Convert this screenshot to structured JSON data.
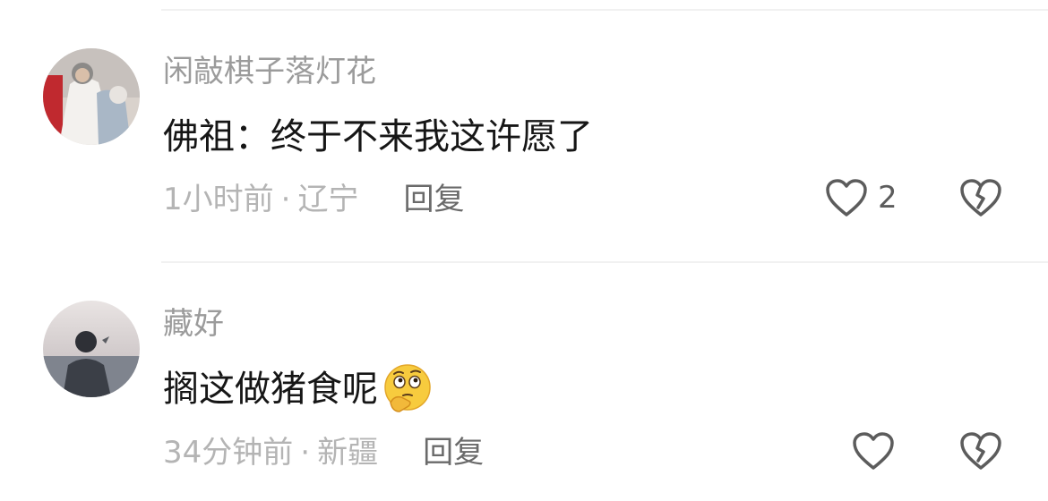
{
  "comments": [
    {
      "username": "闲敲棋子落灯花",
      "text": "佛祖：终于不来我这许愿了",
      "time": "1小时前",
      "separator": "·",
      "location": "辽宁",
      "reply_label": "回复",
      "like_count": "2",
      "like_icon": "heart-outline-icon",
      "dislike_icon": "broken-heart-icon"
    },
    {
      "username": "藏好",
      "text": "搁这做猪食呢",
      "emoji": "thinking-face-emoji",
      "time": "34分钟前",
      "separator": "·",
      "location": "新疆",
      "reply_label": "回复",
      "like_count": "",
      "like_icon": "heart-outline-icon",
      "dislike_icon": "broken-heart-icon"
    }
  ],
  "colors": {
    "username": "#9b9b9b",
    "text": "#161616",
    "meta": "#b4b4b4",
    "reply": "#6a6a6a",
    "icon": "#5c5c5c",
    "divider": "#f1f1f1"
  }
}
